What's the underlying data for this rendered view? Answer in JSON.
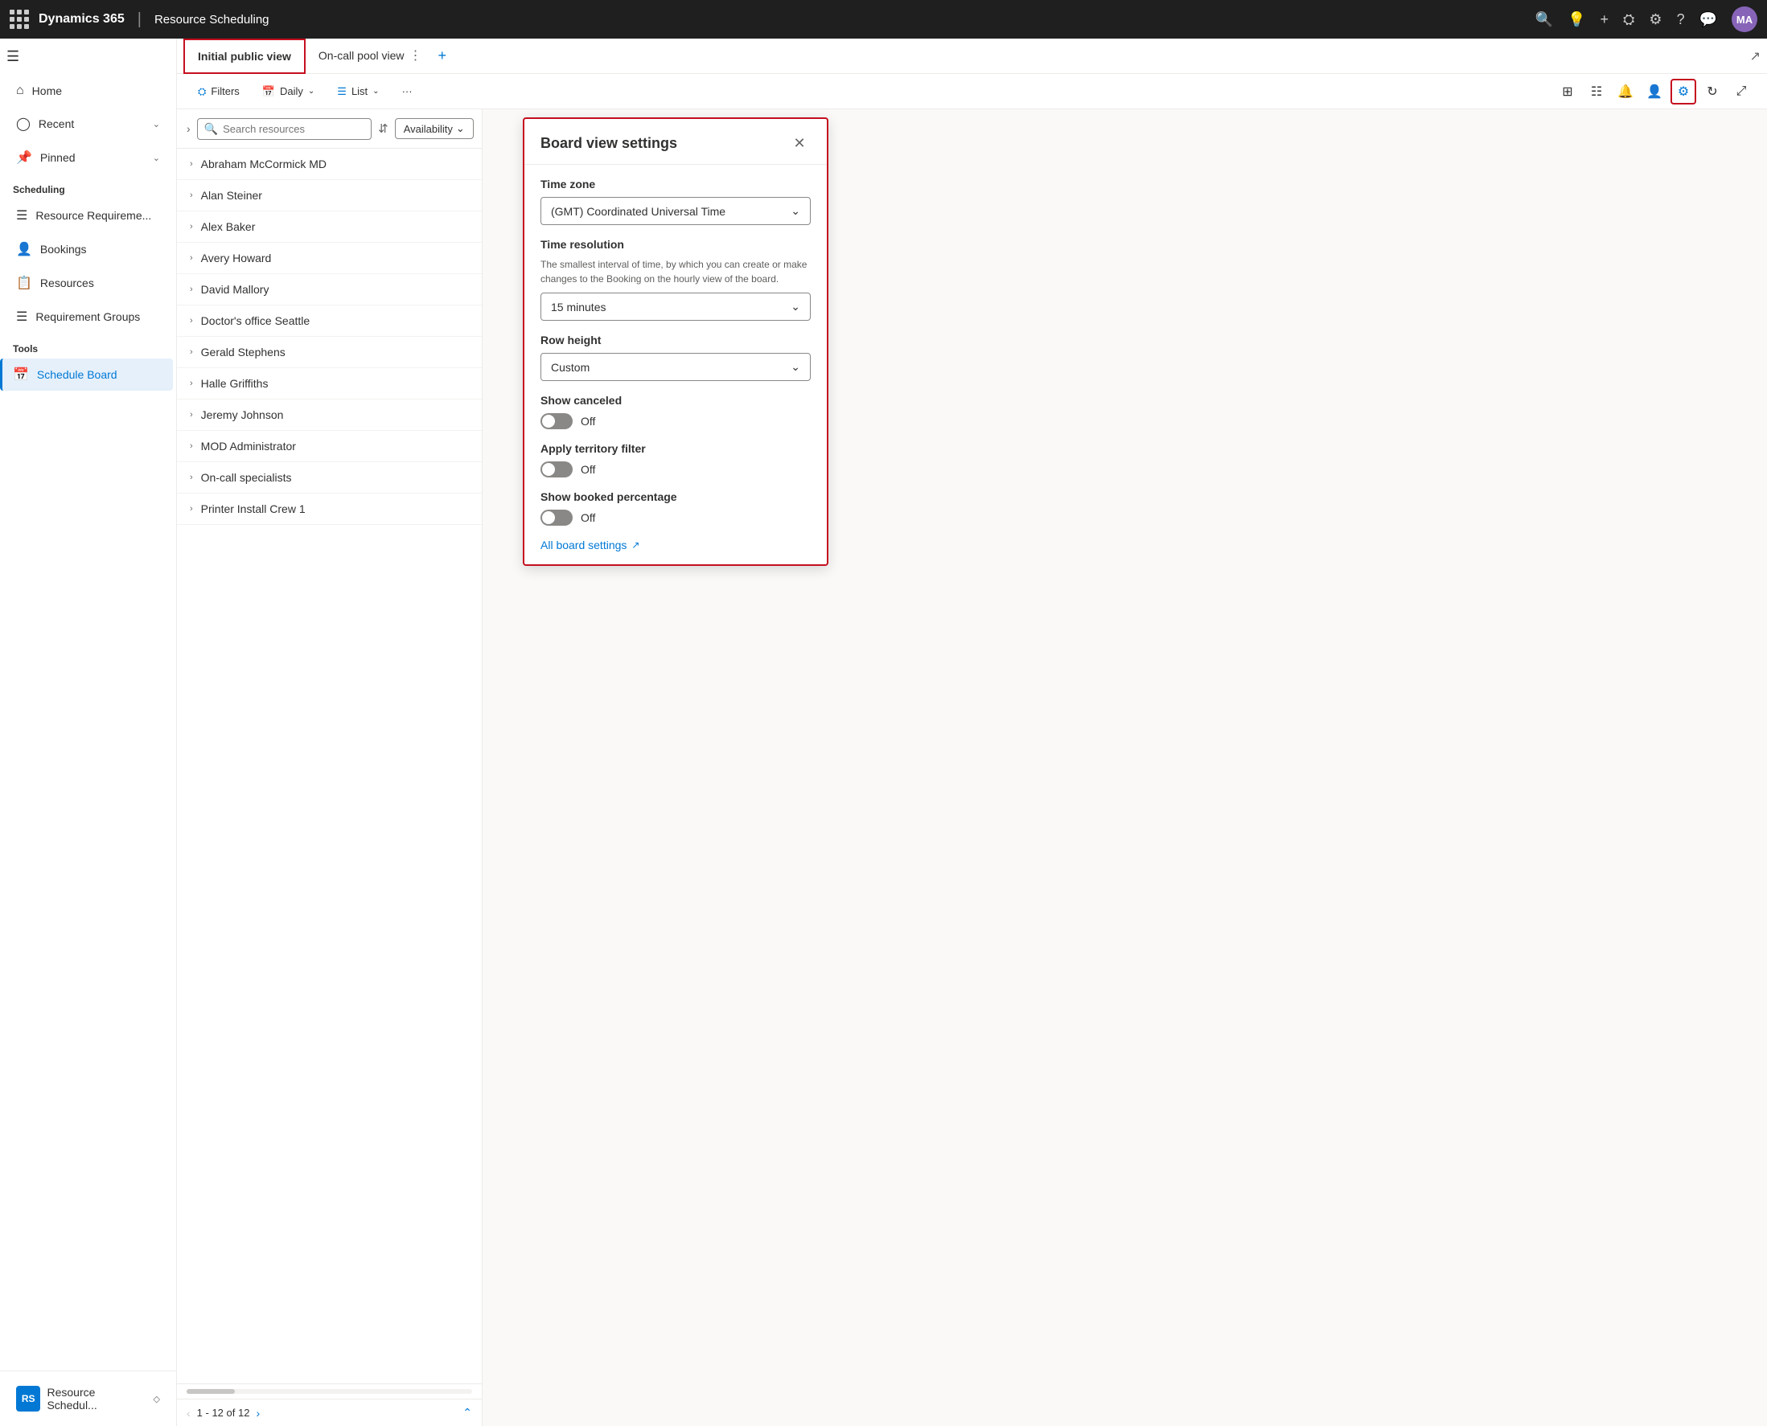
{
  "topNav": {
    "brand": "Dynamics 365",
    "separator": "|",
    "module": "Resource Scheduling",
    "avatarText": "MA",
    "icons": [
      "search",
      "lightbulb",
      "plus",
      "filter",
      "settings",
      "help",
      "chat"
    ]
  },
  "sidebar": {
    "hamburgerLabel": "☰",
    "navItems": [
      {
        "label": "Home",
        "icon": "⌂",
        "hasChevron": false
      },
      {
        "label": "Recent",
        "icon": "◷",
        "hasChevron": true
      },
      {
        "label": "Pinned",
        "icon": "📌",
        "hasChevron": true
      }
    ],
    "sections": [
      {
        "header": "Scheduling",
        "items": [
          {
            "label": "Resource Requireme...",
            "icon": "☰"
          },
          {
            "label": "Bookings",
            "icon": "👤"
          },
          {
            "label": "Resources",
            "icon": "📋"
          },
          {
            "label": "Requirement Groups",
            "icon": "☰"
          }
        ]
      },
      {
        "header": "Tools",
        "items": [
          {
            "label": "Schedule Board",
            "icon": "📅",
            "active": true
          }
        ]
      }
    ],
    "bottomBadge": "RS",
    "bottomLabel": "Resource Schedul...",
    "bottomChevron": "◇"
  },
  "tabs": [
    {
      "label": "Initial public view",
      "active": true
    },
    {
      "label": "On-call pool view",
      "active": false
    }
  ],
  "toolbar": {
    "filterLabel": "Filters",
    "dailyLabel": "Daily",
    "listLabel": "List",
    "moreLabel": "···",
    "rightIcons": [
      {
        "name": "table-icon",
        "symbol": "⊞"
      },
      {
        "name": "list-view-icon",
        "symbol": "☰"
      },
      {
        "name": "bell-icon",
        "symbol": "🔔"
      },
      {
        "name": "person-icon",
        "symbol": "👤"
      },
      {
        "name": "settings-icon",
        "symbol": "⚙",
        "active": true
      },
      {
        "name": "refresh-icon",
        "symbol": "↺"
      },
      {
        "name": "expand-icon",
        "symbol": "⤢"
      }
    ]
  },
  "resourceList": {
    "searchPlaceholder": "Search resources",
    "availabilityLabel": "Availability",
    "resources": [
      {
        "name": "Abraham McCormick MD"
      },
      {
        "name": "Alan Steiner"
      },
      {
        "name": "Alex Baker"
      },
      {
        "name": "Avery Howard"
      },
      {
        "name": "David Mallory"
      },
      {
        "name": "Doctor's office Seattle"
      },
      {
        "name": "Gerald Stephens"
      },
      {
        "name": "Halle Griffiths"
      },
      {
        "name": "Jeremy Johnson"
      },
      {
        "name": "MOD Administrator"
      },
      {
        "name": "On-call specialists"
      },
      {
        "name": "Printer Install Crew 1"
      }
    ],
    "pagination": "1 - 12 of 12"
  },
  "settingsPanel": {
    "title": "Board view settings",
    "timeZone": {
      "label": "Time zone",
      "value": "(GMT) Coordinated Universal Time"
    },
    "timeResolution": {
      "label": "Time resolution",
      "description": "The smallest interval of time, by which you can create or make changes to the Booking on the hourly view of the board.",
      "value": "15 minutes"
    },
    "rowHeight": {
      "label": "Row height",
      "value": "Custom"
    },
    "showCanceled": {
      "label": "Show canceled",
      "value": "Off",
      "enabled": false
    },
    "applyTerritoryFilter": {
      "label": "Apply territory filter",
      "value": "Off",
      "enabled": false
    },
    "showBookedPercentage": {
      "label": "Show booked percentage",
      "value": "Off",
      "enabled": false
    },
    "allBoardSettingsLink": "All board settings"
  }
}
